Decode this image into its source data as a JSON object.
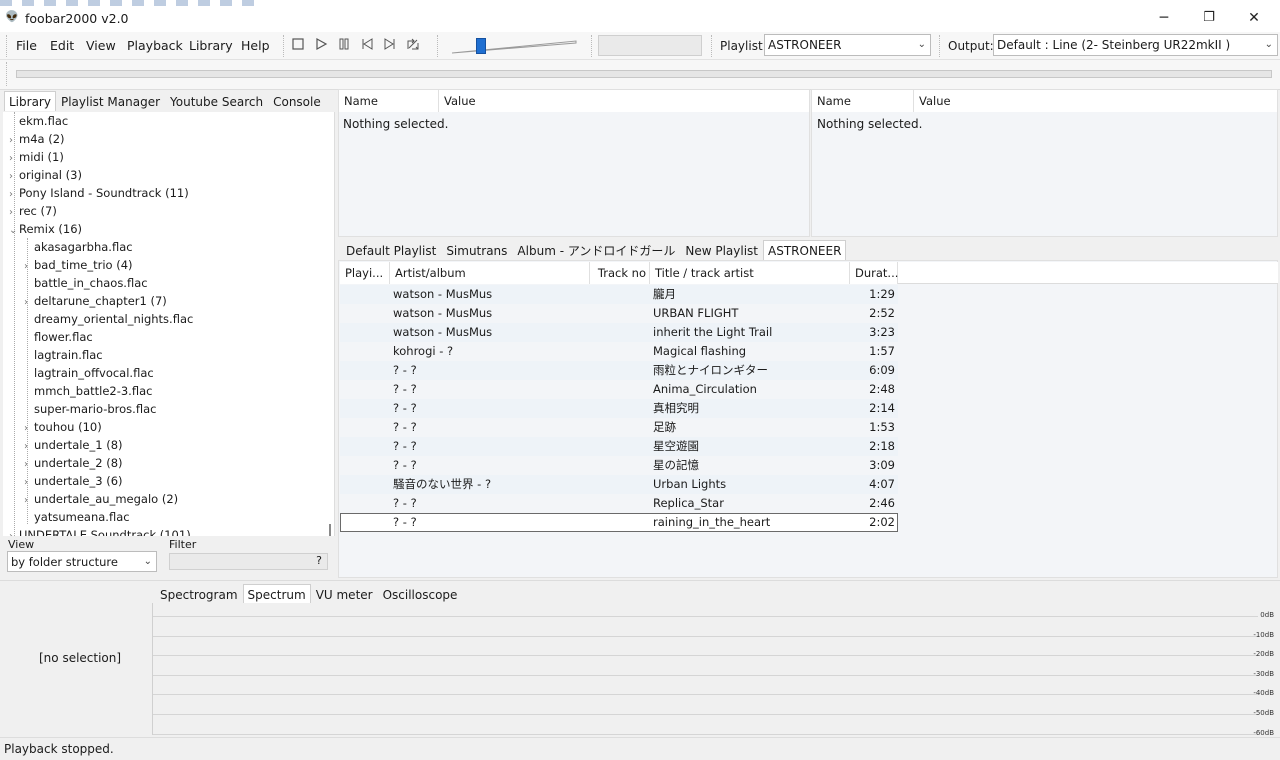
{
  "window": {
    "title": "foobar2000 v2.0",
    "minimize": "─",
    "restore": "❐",
    "close": "✕",
    "logo": "👽"
  },
  "menu": [
    "File",
    "Edit",
    "View",
    "Playback",
    "Library",
    "Help"
  ],
  "transport": [
    "stop-icon",
    "play-icon",
    "pause-icon",
    "previous-icon",
    "next-icon",
    "random-icon"
  ],
  "volume": {
    "level": 0.22
  },
  "playlist_selector": {
    "label": "Playlist:",
    "value": "ASTRONEER"
  },
  "output_selector": {
    "label": "Output:",
    "value": "Default : Line (2- Steinberg UR22mkII )"
  },
  "left_tabs": [
    "Library",
    "Playlist Manager",
    "Youtube Search",
    "Console"
  ],
  "tree": [
    {
      "label": "ekm.flac",
      "level": 0,
      "expand": ""
    },
    {
      "label": "m4a (2)",
      "level": 0,
      "expand": "›"
    },
    {
      "label": "midi (1)",
      "level": 0,
      "expand": "›"
    },
    {
      "label": "original (3)",
      "level": 0,
      "expand": "›"
    },
    {
      "label": "Pony Island - Soundtrack (11)",
      "level": 0,
      "expand": "›"
    },
    {
      "label": "rec (7)",
      "level": 0,
      "expand": "›"
    },
    {
      "label": "Remix (16)",
      "level": 0,
      "expand": "⌄"
    },
    {
      "label": "akasagarbha.flac",
      "level": 1,
      "expand": ""
    },
    {
      "label": "bad_time_trio (4)",
      "level": 1,
      "expand": "›"
    },
    {
      "label": "battle_in_chaos.flac",
      "level": 1,
      "expand": ""
    },
    {
      "label": "deltarune_chapter1 (7)",
      "level": 1,
      "expand": "›"
    },
    {
      "label": "dreamy_oriental_nights.flac",
      "level": 1,
      "expand": ""
    },
    {
      "label": "flower.flac",
      "level": 1,
      "expand": ""
    },
    {
      "label": "lagtrain.flac",
      "level": 1,
      "expand": ""
    },
    {
      "label": "lagtrain_offvocal.flac",
      "level": 1,
      "expand": ""
    },
    {
      "label": "mmch_battle2-3.flac",
      "level": 1,
      "expand": ""
    },
    {
      "label": "super-mario-bros.flac",
      "level": 1,
      "expand": ""
    },
    {
      "label": "touhou (10)",
      "level": 1,
      "expand": "›"
    },
    {
      "label": "undertale_1 (8)",
      "level": 1,
      "expand": "›"
    },
    {
      "label": "undertale_2 (8)",
      "level": 1,
      "expand": "›"
    },
    {
      "label": "undertale_3 (6)",
      "level": 1,
      "expand": "›"
    },
    {
      "label": "undertale_au_megalo (2)",
      "level": 1,
      "expand": "›"
    },
    {
      "label": "yatsumeana.flac",
      "level": 1,
      "expand": ""
    },
    {
      "label": "UNDERTALE Soundtrack (101)",
      "level": 0,
      "expand": "›"
    }
  ],
  "view": {
    "label": "View",
    "value": "by folder structure"
  },
  "filter": {
    "label": "Filter",
    "help": "?"
  },
  "props_left": {
    "name_header": "Name",
    "value_header": "Value",
    "empty": "Nothing selected."
  },
  "props_right": {
    "name_header": "Name",
    "value_header": "Value",
    "empty": "Nothing selected."
  },
  "playlist_tabs": [
    "Default Playlist",
    "Simutrans",
    "Album - アンドロイドガール",
    "New Playlist",
    "ASTRONEER"
  ],
  "playlist_columns": [
    "Playi...",
    "Artist/album",
    "Track no",
    "Title / track artist",
    "Durat..."
  ],
  "tracks": [
    {
      "artist": "watson - MusMus",
      "title": "朧月",
      "duration": "1:29"
    },
    {
      "artist": "watson - MusMus",
      "title": "URBAN FLIGHT",
      "duration": "2:52"
    },
    {
      "artist": "watson - MusMus",
      "title": "inherit the Light Trail",
      "duration": "3:23"
    },
    {
      "artist": "kohrogi - ?",
      "title": "Magical flashing",
      "duration": "1:57"
    },
    {
      "artist": "? - ?",
      "title": "雨粒とナイロンギター",
      "duration": "6:09"
    },
    {
      "artist": "? - ?",
      "title": "Anima_Circulation",
      "duration": "2:48"
    },
    {
      "artist": "? - ?",
      "title": "真相究明",
      "duration": "2:14"
    },
    {
      "artist": "? - ?",
      "title": "足跡",
      "duration": "1:53"
    },
    {
      "artist": "? - ?",
      "title": "星空遊園",
      "duration": "2:18"
    },
    {
      "artist": "? - ?",
      "title": "星の記憶",
      "duration": "3:09"
    },
    {
      "artist": "騒音のない世界 - ?",
      "title": "Urban Lights",
      "duration": "4:07"
    },
    {
      "artist": "? - ?",
      "title": "Replica_Star",
      "duration": "2:46"
    },
    {
      "artist": "? - ?",
      "title": "raining_in_the_heart",
      "duration": "2:02"
    }
  ],
  "selection_panel": {
    "text": "[no selection]"
  },
  "vis_tabs": [
    "Spectrogram",
    "Spectrum",
    "VU meter",
    "Oscilloscope"
  ],
  "db_labels": [
    "0dB",
    "-10dB",
    "-20dB",
    "-30dB",
    "-40dB",
    "-50dB",
    "-60dB"
  ],
  "status": "Playback stopped."
}
